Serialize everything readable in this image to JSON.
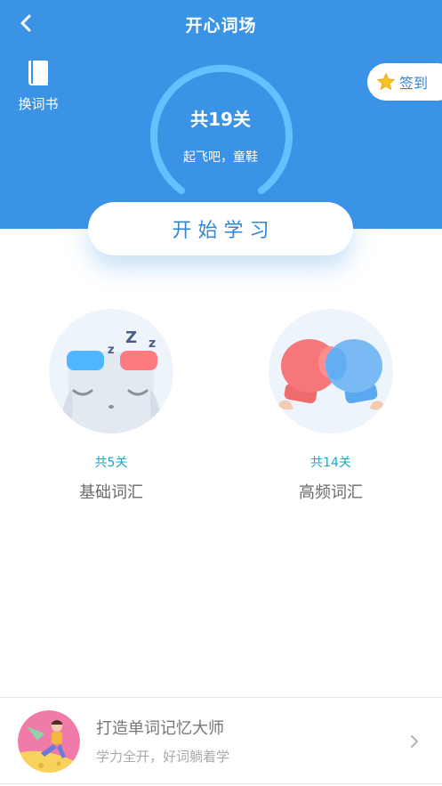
{
  "header": {
    "title": "开心词场",
    "change_book_label": "换词书",
    "checkin_label": "签到",
    "accent_color": "#3b93e6"
  },
  "progress": {
    "total_levels_text": "共19关",
    "subtitle": "起飞吧，童鞋"
  },
  "start_button": {
    "label": "开始学习"
  },
  "categories": [
    {
      "count_text": "共5关",
      "name": "基础词汇",
      "icon": "sleeping-character-icon"
    },
    {
      "count_text": "共14关",
      "name": "高频词汇",
      "icon": "boxing-gloves-icon"
    }
  ],
  "promo": {
    "title": "打造单词记忆大师",
    "subtitle": "学力全开，好词躺着学",
    "icon": "flying-boy-avatar"
  }
}
